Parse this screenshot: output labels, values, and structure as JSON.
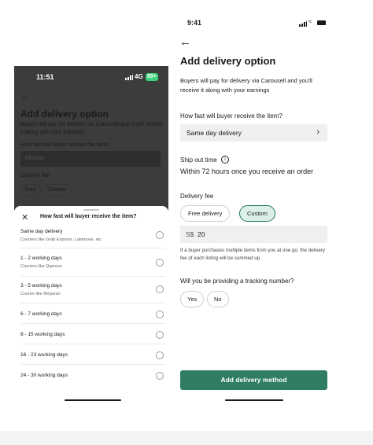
{
  "left_screen": {
    "status": {
      "time": "11:51",
      "network": "4G",
      "battery": "99+"
    },
    "background": {
      "title": "Add delivery option",
      "subtitle": "Buyers will pay for delivery via Carousell and you'll receive it along with your earnings",
      "question": "How fast will buyer receive the item?",
      "select_value": "Choose",
      "fee_label": "Delivery fee",
      "chips": [
        "Free",
        "Custom"
      ]
    },
    "sheet": {
      "title": "How fast will buyer receive the item?",
      "options": [
        {
          "title": "Same day delivery",
          "sub": "Couriers like Grab Express, Lalamove, etc"
        },
        {
          "title": "1 - 2 working days",
          "sub": "Couriers like Qxpress"
        },
        {
          "title": "3 - 5 working days",
          "sub": "Courier like Ninjavan"
        },
        {
          "title": "6 - 7 working days",
          "sub": ""
        },
        {
          "title": "8 - 15 working days",
          "sub": ""
        },
        {
          "title": "16 - 23 working days",
          "sub": ""
        },
        {
          "title": "24 - 30 working days",
          "sub": ""
        }
      ]
    }
  },
  "right_screen": {
    "status": {
      "time": "9:41"
    },
    "title": "Add delivery option",
    "subtitle": "Buyers will pay for delivery via Carousell and you'll receive it along with your earnings",
    "speed_question": "How fast will buyer receive the item?",
    "speed_value": "Same day delivery",
    "ship_out_label": "Ship out time",
    "ship_out_value": "Within 72 hours once you receive an order",
    "fee_label": "Delivery fee",
    "fee_options": [
      "Free delivery",
      "Custom"
    ],
    "selected_fee_option": "Custom",
    "currency": "S$",
    "amount": "20",
    "note": "If a buyer purchases multiple items from you at one go, the delivery fee of each listing will be summed up.",
    "tracking_question": "Will you be providing a tracking number?",
    "tracking_options": [
      "Yes",
      "No"
    ],
    "cta_label": "Add delivery method",
    "accent_color": "#2f7e63",
    "chip_active_bg": "#dcefe7"
  }
}
